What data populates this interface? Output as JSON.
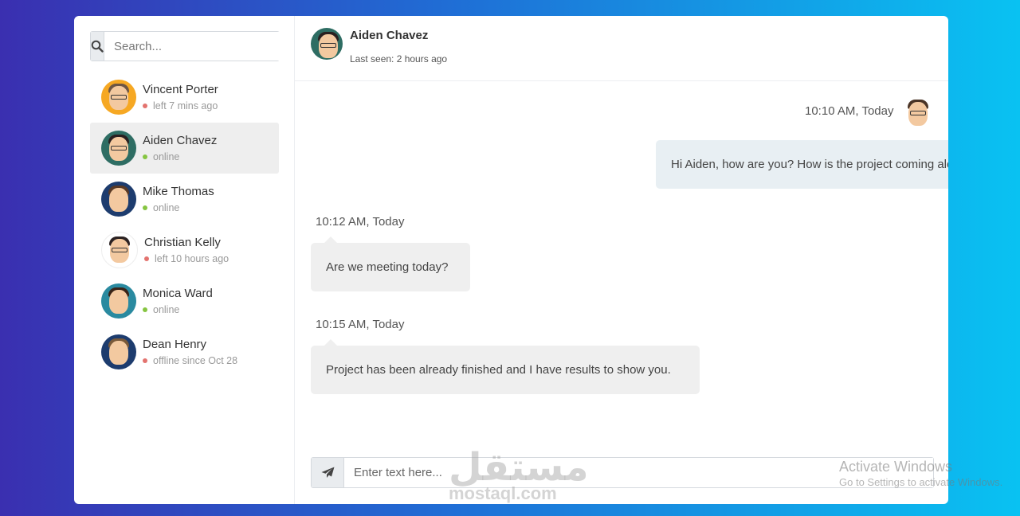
{
  "search": {
    "placeholder": "Search..."
  },
  "contacts": [
    {
      "name": "Vincent Porter",
      "status": "left 7 mins ago",
      "online": false,
      "avatar_bg": "#f6a823",
      "hair": "#6d5545",
      "glasses": true
    },
    {
      "name": "Aiden Chavez",
      "status": "online",
      "online": true,
      "avatar_bg": "#2e6d63",
      "hair": "#2a2020",
      "glasses": true,
      "active": true
    },
    {
      "name": "Mike Thomas",
      "status": "online",
      "online": true,
      "avatar_bg": "#1d3c6e",
      "hair": "#5a3a25",
      "glasses": false
    },
    {
      "name": "Christian Kelly",
      "status": "left 10 hours ago",
      "online": false,
      "avatar_bg": "#ffffff",
      "hair": "#2b2222",
      "glasses": true
    },
    {
      "name": "Monica Ward",
      "status": "online",
      "online": true,
      "avatar_bg": "#2a8aa0",
      "hair": "#3a2418",
      "glasses": false
    },
    {
      "name": "Dean Henry",
      "status": "offline since Oct 28",
      "online": false,
      "avatar_bg": "#1d3c6e",
      "hair": "#7a5a3a",
      "glasses": false
    }
  ],
  "header": {
    "name": "Aiden Chavez",
    "last_seen": "Last seen: 2 hours ago"
  },
  "messages": [
    {
      "time": "10:10 AM, Today",
      "text": "Hi Aiden, how are you? How is the project coming along?",
      "direction": "out"
    },
    {
      "time": "10:12 AM, Today",
      "text": "Are we meeting today?",
      "direction": "in"
    },
    {
      "time": "10:15 AM, Today",
      "text": "Project has been already finished and I have results to show you.",
      "direction": "in"
    }
  ],
  "composer": {
    "placeholder": "Enter text here..."
  },
  "watermark": {
    "arabic": "مستقل",
    "latin": "mostaql.com"
  },
  "os_notice": {
    "title": "Activate Windows",
    "subtitle": "Go to Settings to activate Windows."
  },
  "colors": {
    "online": "#86c541",
    "offline": "#e3736f",
    "accent_bg_from": "#3a2fb0",
    "accent_bg_to": "#09c2f2"
  }
}
